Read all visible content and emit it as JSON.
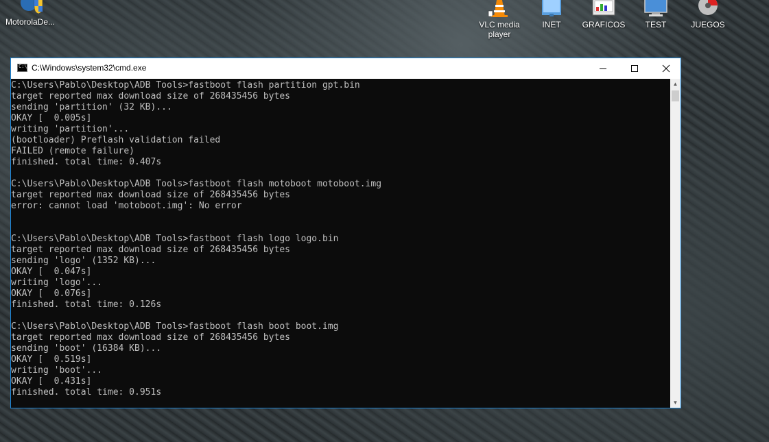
{
  "desktop": {
    "icons": [
      {
        "label": "MotorolaDe...",
        "icon": "motorola-shield-icon"
      },
      {
        "label": "VLC media player",
        "icon": "vlc-cone-icon"
      },
      {
        "label": "INET",
        "icon": "network-folder-icon"
      },
      {
        "label": "GRAFICOS",
        "icon": "graphics-folder-icon"
      },
      {
        "label": "TEST",
        "icon": "monitor-icon"
      },
      {
        "label": "JUEGOS",
        "icon": "disc-icon"
      }
    ]
  },
  "window": {
    "title": "C:\\Windows\\system32\\cmd.exe",
    "minimize": "—",
    "maximize": "☐",
    "close": "✕"
  },
  "console": {
    "lines": [
      "C:\\Users\\Pablo\\Desktop\\ADB Tools>fastboot flash partition gpt.bin",
      "target reported max download size of 268435456 bytes",
      "sending 'partition' (32 KB)...",
      "OKAY [  0.005s]",
      "writing 'partition'...",
      "(bootloader) Preflash validation failed",
      "FAILED (remote failure)",
      "finished. total time: 0.407s",
      "",
      "C:\\Users\\Pablo\\Desktop\\ADB Tools>fastboot flash motoboot motoboot.img",
      "target reported max download size of 268435456 bytes",
      "error: cannot load 'motoboot.img': No error",
      "",
      "",
      "C:\\Users\\Pablo\\Desktop\\ADB Tools>fastboot flash logo logo.bin",
      "target reported max download size of 268435456 bytes",
      "sending 'logo' (1352 KB)...",
      "OKAY [  0.047s]",
      "writing 'logo'...",
      "OKAY [  0.076s]",
      "finished. total time: 0.126s",
      "",
      "C:\\Users\\Pablo\\Desktop\\ADB Tools>fastboot flash boot boot.img",
      "target reported max download size of 268435456 bytes",
      "sending 'boot' (16384 KB)...",
      "OKAY [  0.519s]",
      "writing 'boot'...",
      "OKAY [  0.431s]",
      "finished. total time: 0.951s"
    ]
  },
  "scrollbar": {
    "up": "▲",
    "down": "▼"
  },
  "colors": {
    "console_bg": "#0c0c0c",
    "console_text": "#c0c0c0",
    "window_border": "#1c86d9"
  }
}
